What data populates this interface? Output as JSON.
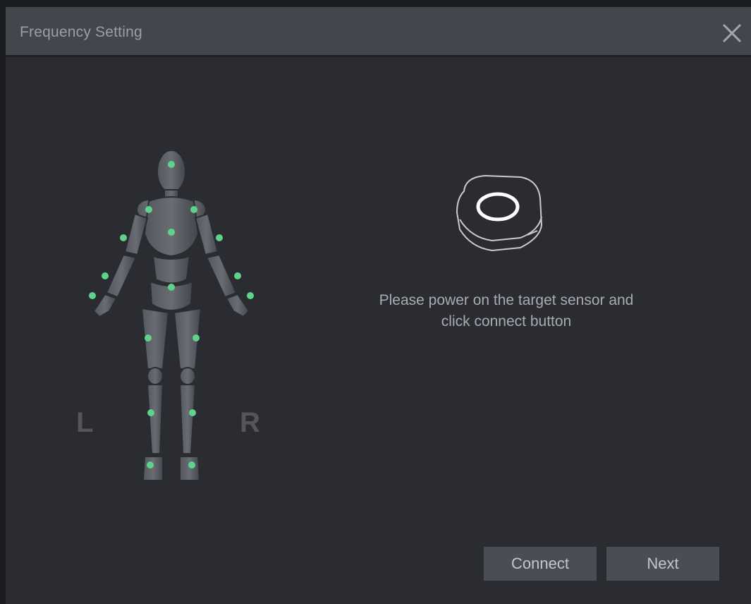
{
  "window": {
    "title": "Frequency Setting"
  },
  "body_figure": {
    "left_label": "L",
    "right_label": "R"
  },
  "instructions": {
    "line1": "Please power on the target sensor and",
    "line2": "click connect button"
  },
  "buttons": {
    "connect_label": "Connect",
    "next_label": "Next"
  },
  "colors": {
    "sensor_dot": "#5fd38a",
    "accent_ring": "#ffffff"
  }
}
